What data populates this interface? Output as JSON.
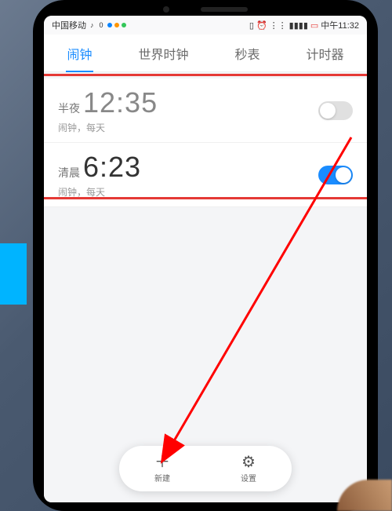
{
  "statusbar": {
    "carrier": "中国移动",
    "extra": "0",
    "time_label": "中午11:32"
  },
  "tabs": [
    {
      "label": "闹钟",
      "active": true
    },
    {
      "label": "世界时钟",
      "active": false
    },
    {
      "label": "秒表",
      "active": false
    },
    {
      "label": "计时器",
      "active": false
    }
  ],
  "alarms": [
    {
      "period": "半夜",
      "time": "12:35",
      "sub": "闹钟，每天",
      "enabled": false
    },
    {
      "period": "清晨",
      "time": "6:23",
      "sub": "闹钟，每天",
      "enabled": true
    }
  ],
  "bottombar": {
    "new_label": "新建",
    "settings_label": "设置"
  },
  "colors": {
    "accent": "#1a8cff",
    "highlight": "#e53935",
    "arrow": "#ff0000"
  }
}
